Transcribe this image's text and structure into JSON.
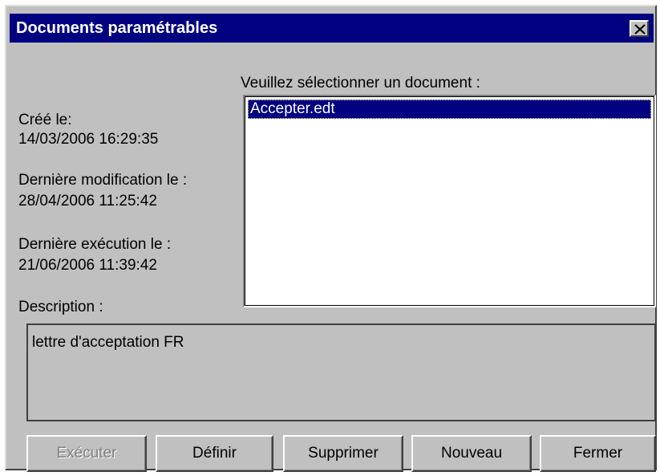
{
  "window": {
    "title": "Documents paramétrables",
    "close_icon": "close-icon"
  },
  "info": {
    "created_label": "Créé le:",
    "created_value": "14/03/2006 16:29:35",
    "modified_label": "Dernière modification le :",
    "modified_value": "28/04/2006 11:25:42",
    "executed_label": "Dernière exécution le :",
    "executed_value": "21/06/2006 11:39:42",
    "description_label": "Description :",
    "description_value": "lettre d'acceptation FR"
  },
  "document_list": {
    "label": "Veuillez sélectionner un document :",
    "items": [
      {
        "name": "Accepter.edt",
        "selected": true
      }
    ],
    "selection_color": "#000080"
  },
  "buttons": {
    "execute": "Exécuter",
    "define": "Définir",
    "delete": "Supprimer",
    "new": "Nouveau",
    "close": "Fermer"
  },
  "colors": {
    "face": "#c0c0c0",
    "titlebar": "#000080",
    "disabled_text": "#808080"
  }
}
